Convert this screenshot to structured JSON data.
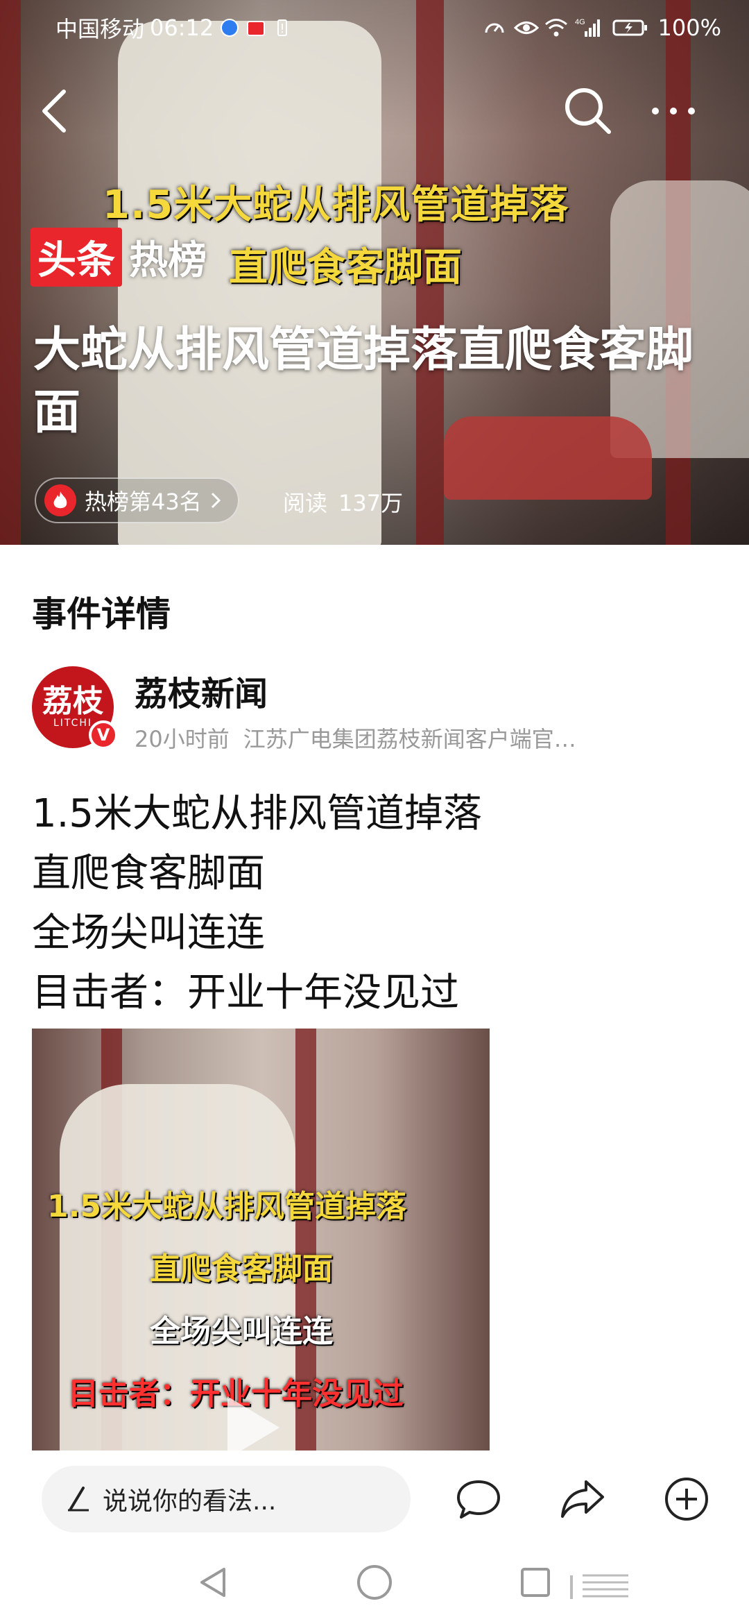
{
  "status_bar": {
    "carrier": "中国移动",
    "time": "06:12",
    "network": "4G",
    "battery": "100%"
  },
  "hero": {
    "video_caption_1": "1.5米大蛇从排风管道掉落",
    "video_caption_2": "直爬食客脚面",
    "logo_red": "头条",
    "logo_white": "热榜",
    "title": "大蛇从排风管道掉落直爬食客脚面",
    "rank_label": "热榜第43名",
    "read_label": "阅读",
    "read_count": "137万"
  },
  "section": {
    "title": "事件详情"
  },
  "author": {
    "avatar_text": "荔枝",
    "avatar_sub": "LITCHI",
    "verified": "V",
    "name": "荔枝新闻",
    "time": "20小时前",
    "description": "江苏广电集团荔枝新闻客户端官…"
  },
  "article": {
    "lines": [
      "1.5米大蛇从排风管道掉落",
      "直爬食客脚面",
      "全场尖叫连连",
      "目击者：开业十年没见过"
    ]
  },
  "video_thumb": {
    "cap1": "1.5米大蛇从排风管道掉落",
    "cap2": "直爬食客脚面",
    "cap3": "全场尖叫连连",
    "cap4": "目击者：开业十年没见过"
  },
  "bottom_bar": {
    "comment_placeholder": "说说你的看法..."
  },
  "colors": {
    "brand_red": "#e8262c",
    "caption_yellow": "#f5d93c"
  }
}
